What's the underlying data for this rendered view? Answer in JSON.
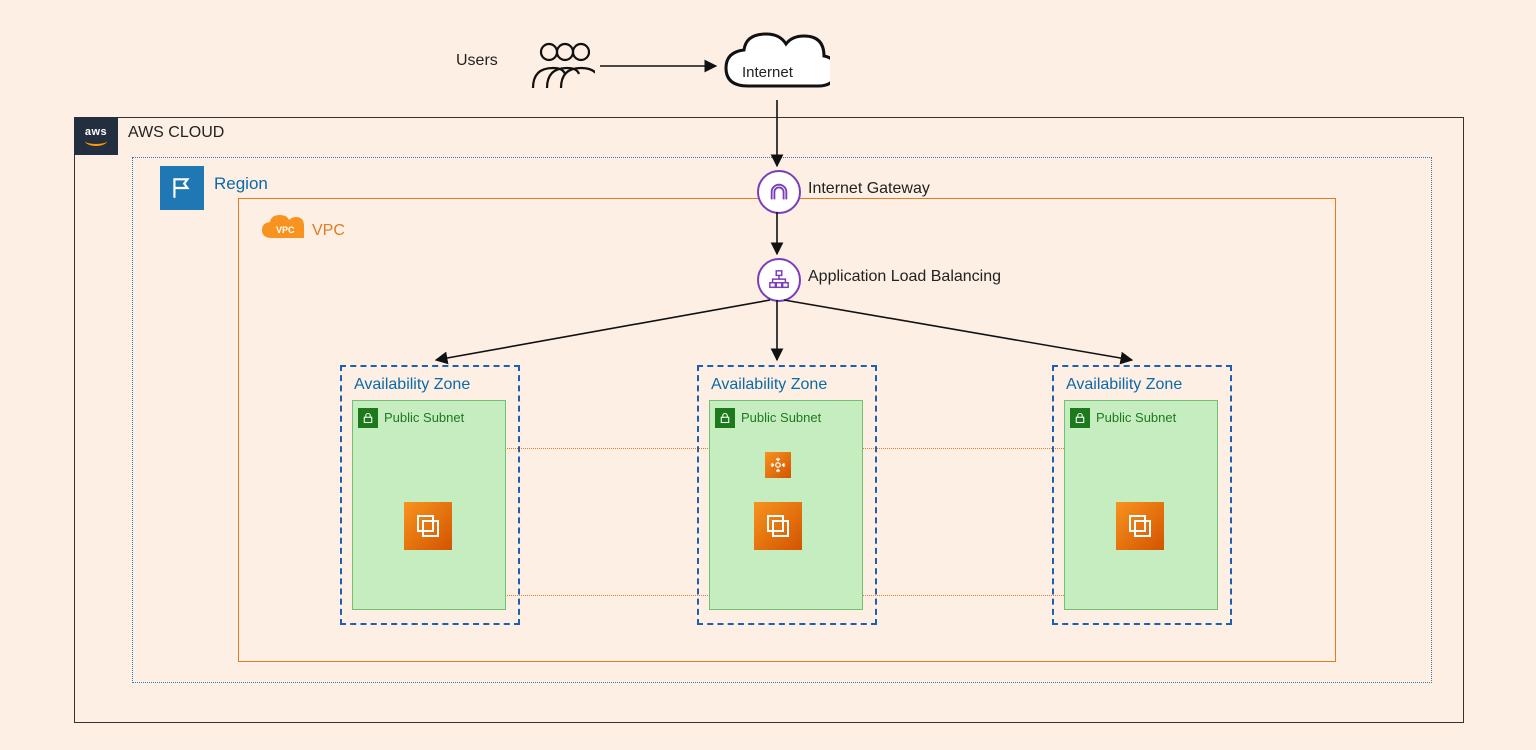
{
  "users_label": "Users",
  "internet_label": "Internet",
  "cloud_label": "AWS CLOUD",
  "region_label": "Region",
  "vpc_label": "VPC",
  "igw_label": "Internet Gateway",
  "alb_label": "Application Load Balancing",
  "az_label": "Availability Zone",
  "subnet_label": "Public Subnet",
  "arrows": [
    {
      "from": "users",
      "to": "internet"
    },
    {
      "from": "internet",
      "to": "internet_gateway"
    },
    {
      "from": "internet_gateway",
      "to": "alb"
    },
    {
      "from": "alb",
      "to": "az1"
    },
    {
      "from": "alb",
      "to": "az2"
    },
    {
      "from": "alb",
      "to": "az3"
    }
  ]
}
